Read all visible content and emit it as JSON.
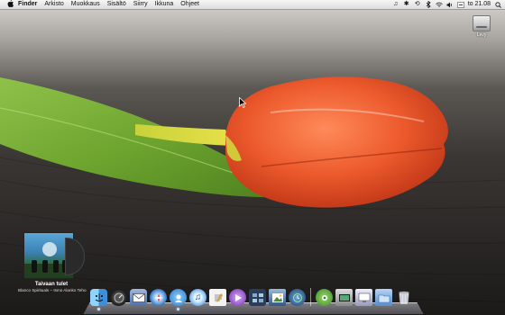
{
  "menubar": {
    "apple": "",
    "items": [
      "Finder",
      "Arkisto",
      "Muokkaus",
      "Sisältö",
      "Siirry",
      "Ikkuna",
      "Ohjeet"
    ],
    "clock": "to 21.08"
  },
  "desktop": {
    "disk_label": "Levy"
  },
  "music_widget": {
    "title": "Taivaan tulet",
    "artist": "Blanco Spirituals – Ismo Alanko Teho"
  },
  "dock": {
    "icons": [
      {
        "name": "finder-icon",
        "running": true
      },
      {
        "name": "dashboard-icon",
        "running": false
      },
      {
        "name": "mail-icon",
        "running": false
      },
      {
        "name": "safari-icon",
        "running": false
      },
      {
        "name": "ichat-icon",
        "running": true
      },
      {
        "name": "itunes-icon",
        "running": false
      },
      {
        "name": "textedit-icon",
        "running": false
      },
      {
        "name": "frontrow-icon",
        "running": false
      },
      {
        "name": "spaces-icon",
        "running": false
      },
      {
        "name": "iphoto-icon",
        "running": false
      },
      {
        "name": "timemachine-icon",
        "running": false
      },
      {
        "name": "system-preferences-icon",
        "running": false
      },
      {
        "name": "app-icon",
        "running": false
      },
      {
        "name": "display-icon",
        "running": false
      },
      {
        "name": "documents-stack-icon",
        "running": false
      },
      {
        "name": "trash-icon",
        "running": false
      }
    ]
  }
}
